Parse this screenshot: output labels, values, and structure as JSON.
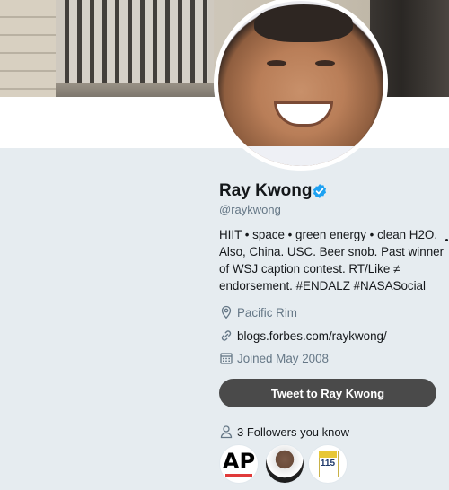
{
  "profile": {
    "name": "Ray Kwong",
    "handle": "@raykwong",
    "verified": true,
    "bio": "HIIT • space • green energy • clean H2O. Also, China. USC. Beer snob. Past winner of WSJ caption contest. RT/Like ≠ endorsement. #ENDALZ #NASASocial",
    "location": "Pacific Rim",
    "website": "blogs.forbes.com/raykwong/",
    "joined": "Joined May 2008"
  },
  "actions": {
    "tweet_to_label": "Tweet to Ray Kwong"
  },
  "followers_you_know": {
    "label": "3 Followers you know",
    "avatars": [
      {
        "name": "ap-avatar",
        "text": "AP"
      },
      {
        "name": "obama-avatar"
      },
      {
        "name": "box-avatar",
        "text": "115"
      }
    ]
  },
  "icons": {
    "location": "map-pin-icon",
    "website": "link-icon",
    "joined": "calendar-icon",
    "followers": "person-icon",
    "verified": "verified-badge-icon"
  },
  "colors": {
    "background": "#e6ecf0",
    "secondary_text": "#657786",
    "verified_blue": "#1da1f2",
    "button": "#4a4a4a"
  }
}
